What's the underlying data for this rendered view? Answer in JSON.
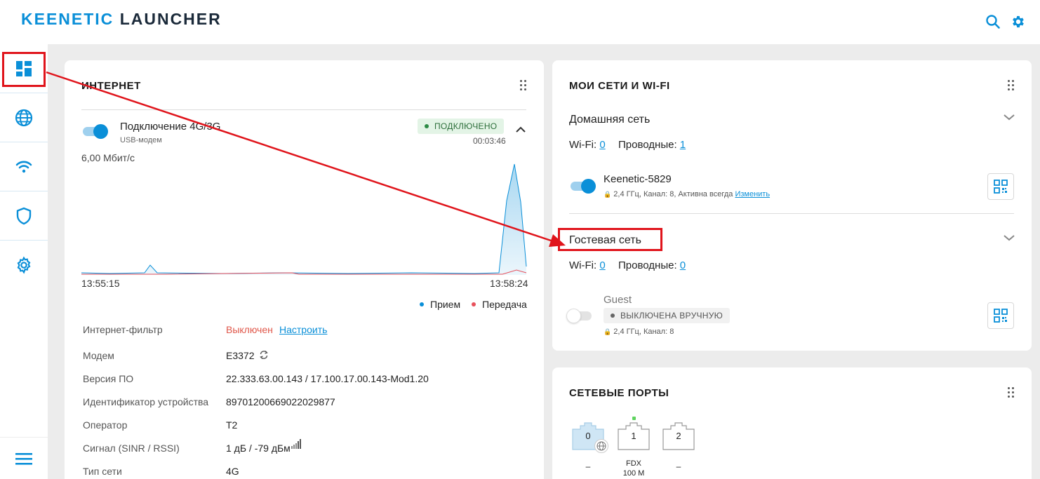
{
  "app": {
    "logo_brand": "KEENETIC",
    "logo_product": "LAUNCHER"
  },
  "colors": {
    "accent": "#0a8fd8",
    "annotation": "#e0141b",
    "rx": "#0a8fd8",
    "tx": "#e8505b"
  },
  "topbar": {
    "icons": [
      "search-icon",
      "gear-icon"
    ]
  },
  "sidebar": {
    "items": [
      "dashboard-icon",
      "globe-icon",
      "wifi-icon",
      "shield-icon",
      "gear-icon"
    ],
    "bottom": "menu-icon"
  },
  "internet": {
    "title": "ИНТЕРНЕТ",
    "connection_name": "Подключение 4G/3G",
    "connection_type": "USB-модем",
    "status": "ПОДКЛЮЧЕНО",
    "uptime": "00:03:46",
    "chart_max": "6,00 Мбит/с",
    "time_start": "13:55:15",
    "time_end": "13:58:24",
    "legend_rx": "Прием",
    "legend_tx": "Передача",
    "filter_label": "Интернет-фильтр",
    "filter_value": "Выключен",
    "filter_link": "Настроить",
    "rows": [
      {
        "label": "Модем",
        "value": "E3372"
      },
      {
        "label": "Версия ПО",
        "value": "22.333.63.00.143 / 17.100.17.00.143-Mod1.20"
      },
      {
        "label": "Идентификатор устройства",
        "value": "89701200669022029877"
      },
      {
        "label": "Оператор",
        "value": "T2"
      },
      {
        "label": "Сигнал (SINR / RSSI)",
        "value": "1 дБ / -79 дБм"
      },
      {
        "label": "Тип сети",
        "value": "4G"
      }
    ]
  },
  "networks": {
    "title": "МОИ СЕТИ И WI-FI",
    "home": {
      "name": "Домашняя сеть",
      "wifi_label": "Wi-Fi:",
      "wifi_count": "0",
      "wired_label": "Проводные:",
      "wired_count": "1",
      "ssid": "Keenetic-5829",
      "details": "2,4 ГГц,  Канал: 8, Активна всегда",
      "edit_link": "Изменить"
    },
    "guest": {
      "name": "Гостевая сеть",
      "wifi_label": "Wi-Fi:",
      "wifi_count": "0",
      "wired_label": "Проводные:",
      "wired_count": "0",
      "ssid": "Guest",
      "status": "ВЫКЛЮЧЕНА ВРУЧНУЮ",
      "details": "2,4 ГГц,  Канал: 8"
    }
  },
  "ports": {
    "title": "СЕТЕВЫЕ ПОРТЫ",
    "items": [
      {
        "num": "0",
        "line1": "–",
        "line2": ""
      },
      {
        "num": "1",
        "line1": "FDX",
        "line2": "100 M"
      },
      {
        "num": "2",
        "line1": "–",
        "line2": ""
      }
    ]
  }
}
